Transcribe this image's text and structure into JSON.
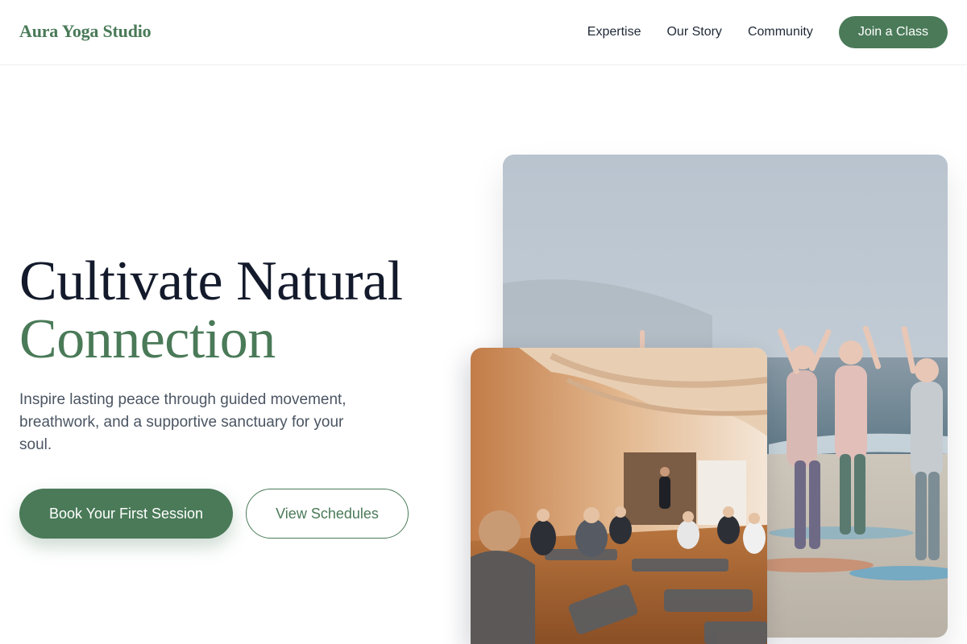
{
  "header": {
    "brand": "Aura Yoga Studio",
    "nav": [
      {
        "label": "Expertise"
      },
      {
        "label": "Our Story"
      },
      {
        "label": "Community"
      }
    ],
    "cta_label": "Join a Class"
  },
  "hero": {
    "title_line1": "Cultivate Natural",
    "title_line2": "Connection",
    "subtitle": "Inspire lasting peace through guided movement, breathwork, and a supportive sanctuary for your soul.",
    "primary_button": "Book Your First Session",
    "secondary_button": "View Schedules"
  },
  "colors": {
    "brand_green": "#4a7a58",
    "heading_navy": "#131a2b",
    "body_gray": "#4b5563"
  }
}
